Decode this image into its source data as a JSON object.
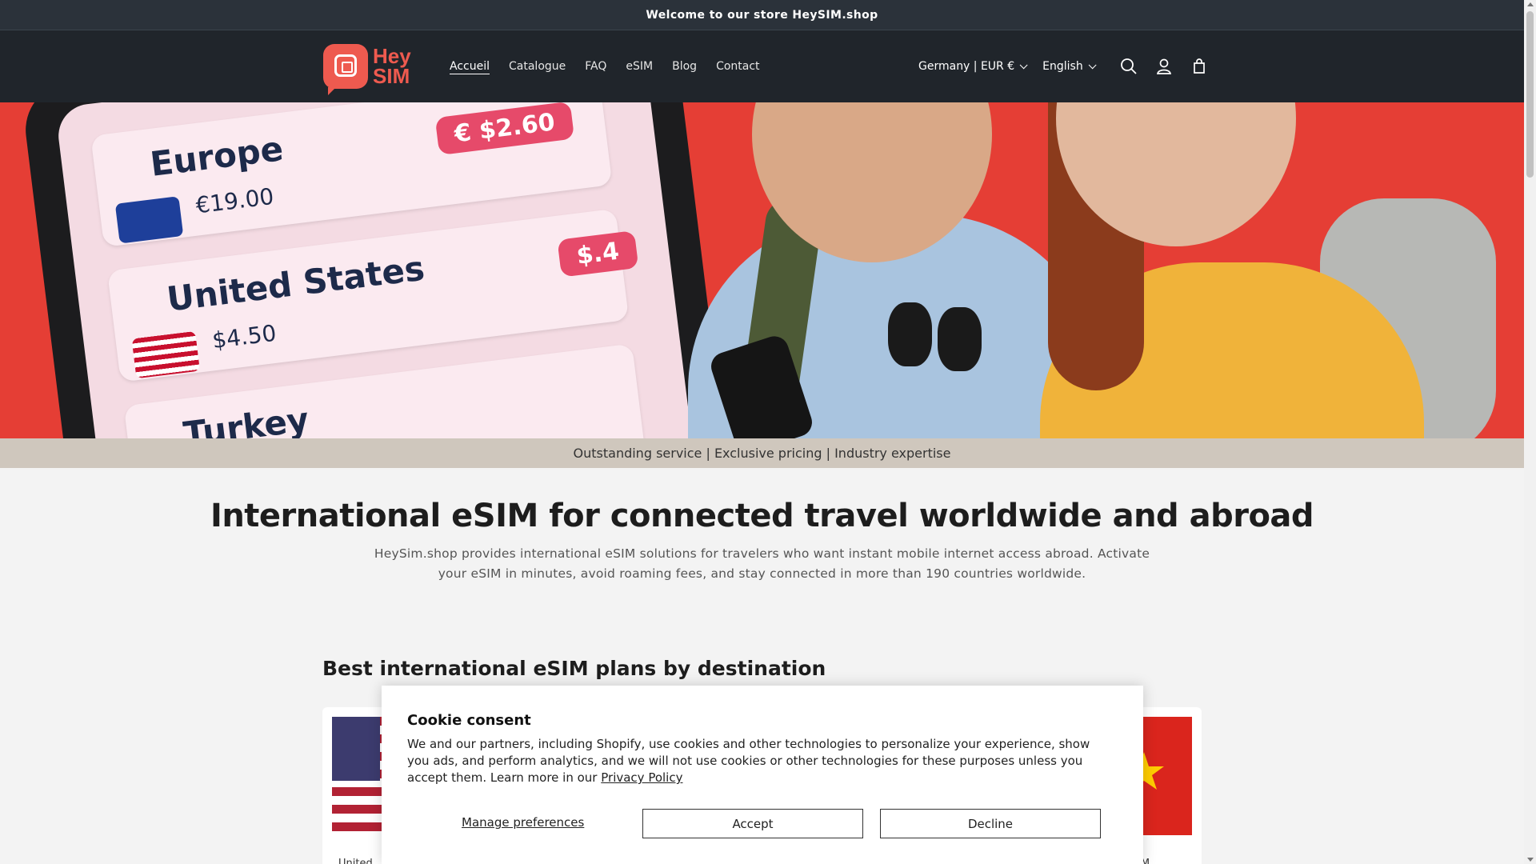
{
  "announcement": "Welcome to our store HeySIM.shop",
  "logo": {
    "line1": "Hey",
    "line2": "SIM"
  },
  "nav": [
    {
      "label": "Accueil",
      "active": true
    },
    {
      "label": "Catalogue"
    },
    {
      "label": "FAQ"
    },
    {
      "label": "eSIM"
    },
    {
      "label": "Blog"
    },
    {
      "label": "Contact"
    }
  ],
  "header": {
    "country": "Germany | EUR €",
    "language": "English",
    "icons": [
      "search-icon",
      "account-icon",
      "cart-icon"
    ]
  },
  "hero": {
    "cards": [
      {
        "destination": "Europe",
        "price": "€19.00",
        "pill": "€ $2.60"
      },
      {
        "destination": "United States",
        "price": "$4.50",
        "pill": "$.4"
      },
      {
        "destination": "Turkey"
      }
    ]
  },
  "usp": "Outstanding service | Exclusive pricing | Industry expertise",
  "intro": {
    "title": "International eSIM for connected travel worldwide and abroad",
    "text": "HeySim.shop provides international eSIM solutions for travelers who want instant mobile internet access abroad. Activate your eSIM in minutes, avoid roaming fees, and stay connected in more than 190 countries worldwide."
  },
  "section": {
    "title": "Best international eSIM plans by destination"
  },
  "products": {
    "left_label": "United",
    "right_label": "IM"
  },
  "cookie": {
    "title": "Cookie consent",
    "text": "We and our partners, including Shopify, use cookies and other technologies to personalize your experience, show you ads, and perform analytics, and we will not use cookies or other technologies for these purposes unless you accept them. Learn more in our",
    "link": "Privacy Policy",
    "manage": "Manage preferences",
    "accept": "Accept",
    "decline": "Decline"
  },
  "colors": {
    "brand": "#ee5a4f",
    "header_bg": "#20252b",
    "hero_bg": "#e53e35"
  }
}
